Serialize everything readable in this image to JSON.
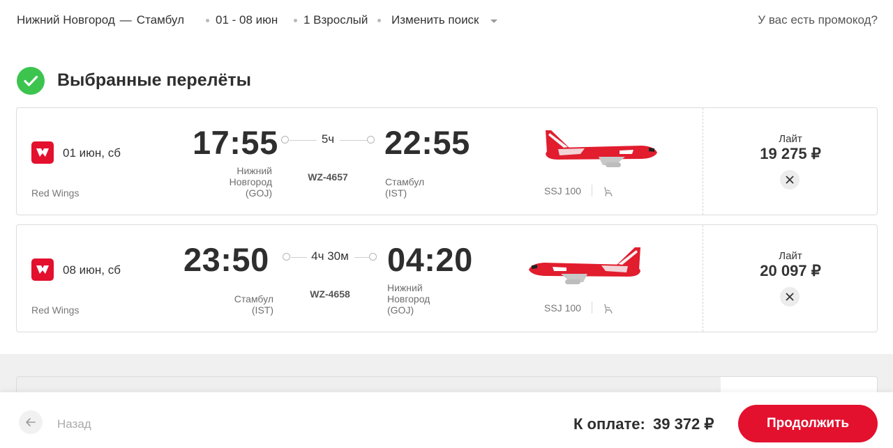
{
  "search": {
    "from": "Нижний Новгород",
    "dash": "—",
    "to": "Стамбул",
    "dates": "01 - 08 июн",
    "passengers": "1 Взрослый",
    "change_label": "Изменить поиск",
    "promo_label": "У вас есть промокод?"
  },
  "section": {
    "title": "Выбранные перелёты"
  },
  "flights": [
    {
      "date": "01 июн, сб",
      "airline": "Red Wings",
      "dep_time": "17:55",
      "dep_place": [
        "Нижний",
        "Новгород",
        "(GOJ)"
      ],
      "duration": "5ч",
      "flight_number": "WZ-4657",
      "arr_time": "22:55",
      "arr_place": [
        "Стамбул",
        "(IST)"
      ],
      "aircraft": "SSJ 100",
      "fare": "Лайт",
      "price": "19 275 ₽"
    },
    {
      "date": "08 июн, сб",
      "airline": "Red Wings",
      "dep_time": "23:50",
      "dep_place": [
        "Стамбул",
        "(IST)"
      ],
      "duration": "4ч 30м",
      "flight_number": "WZ-4658",
      "arr_time": "04:20",
      "arr_place": [
        "Нижний",
        "Новгород",
        "(GOJ)"
      ],
      "aircraft": "SSJ 100",
      "fare": "Лайт",
      "price": "20 097 ₽"
    }
  ],
  "footer": {
    "back_label": "Назад",
    "total_label": "К оплате:",
    "total_value": "39 372 ₽",
    "continue_label": "Продолжить"
  },
  "colors": {
    "brand_red": "#e3102e",
    "check_green": "#3cc44e"
  },
  "icons": {
    "check": "check-icon",
    "airline_logo": "red-wings-logo-icon",
    "plane": "red-wings-plane-icon",
    "seat": "seat-icon",
    "remove": "close-icon",
    "back": "arrow-left-icon",
    "caret": "chevron-down-icon"
  }
}
